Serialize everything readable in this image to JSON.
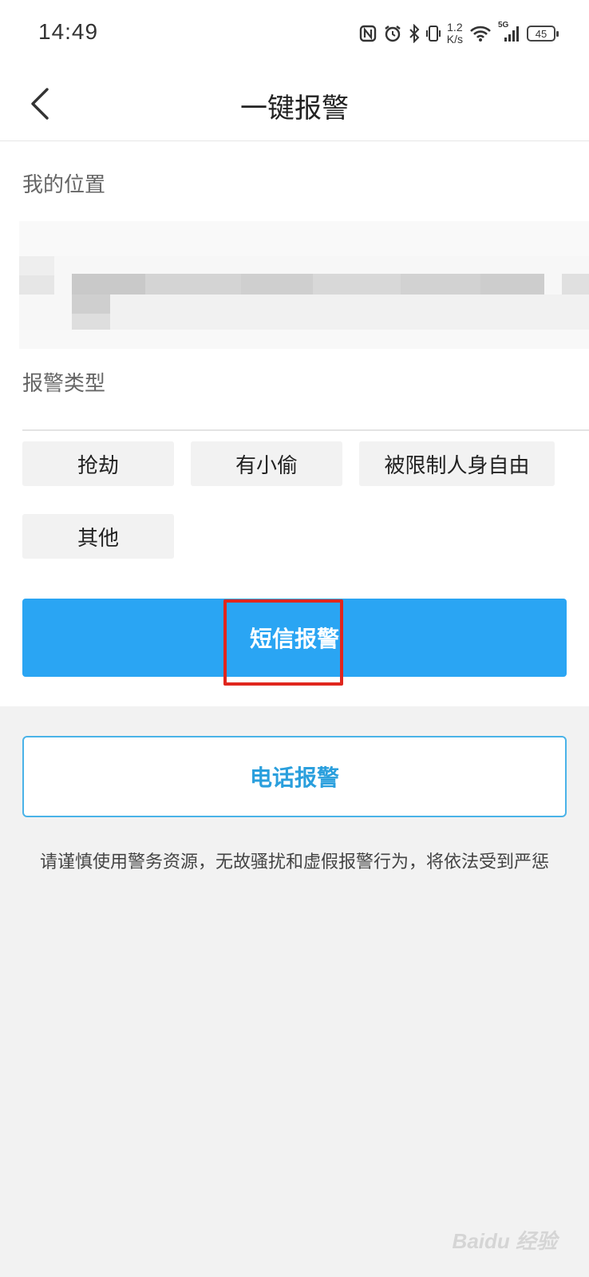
{
  "status_bar": {
    "time": "14:49",
    "net_speed_value": "1.2",
    "net_speed_unit": "K/s",
    "signal_label": "5G",
    "battery": "45",
    "icons": [
      "nfc-icon",
      "alarm-icon",
      "bluetooth-icon",
      "vibrate-icon",
      "wifi-icon",
      "cellular-signal-icon",
      "battery-icon"
    ]
  },
  "header": {
    "title": "一键报警",
    "back_icon": "chevron-left-icon"
  },
  "location": {
    "label": "我的位置"
  },
  "alarm_type": {
    "label": "报警类型",
    "options": [
      "抢劫",
      "有小偷",
      "被限制人身自由",
      "其他"
    ]
  },
  "actions": {
    "sms_label": "短信报警",
    "phone_label": "电话报警"
  },
  "notice": "请谨慎使用警务资源，无故骚扰和虚假报警行为，将依法受到严惩",
  "watermark": "Baidu 经验",
  "colors": {
    "primary": "#2aa5f3",
    "phone_text": "#2a9fdd",
    "highlight": "#e0261d",
    "background": "#f2f2f2"
  }
}
